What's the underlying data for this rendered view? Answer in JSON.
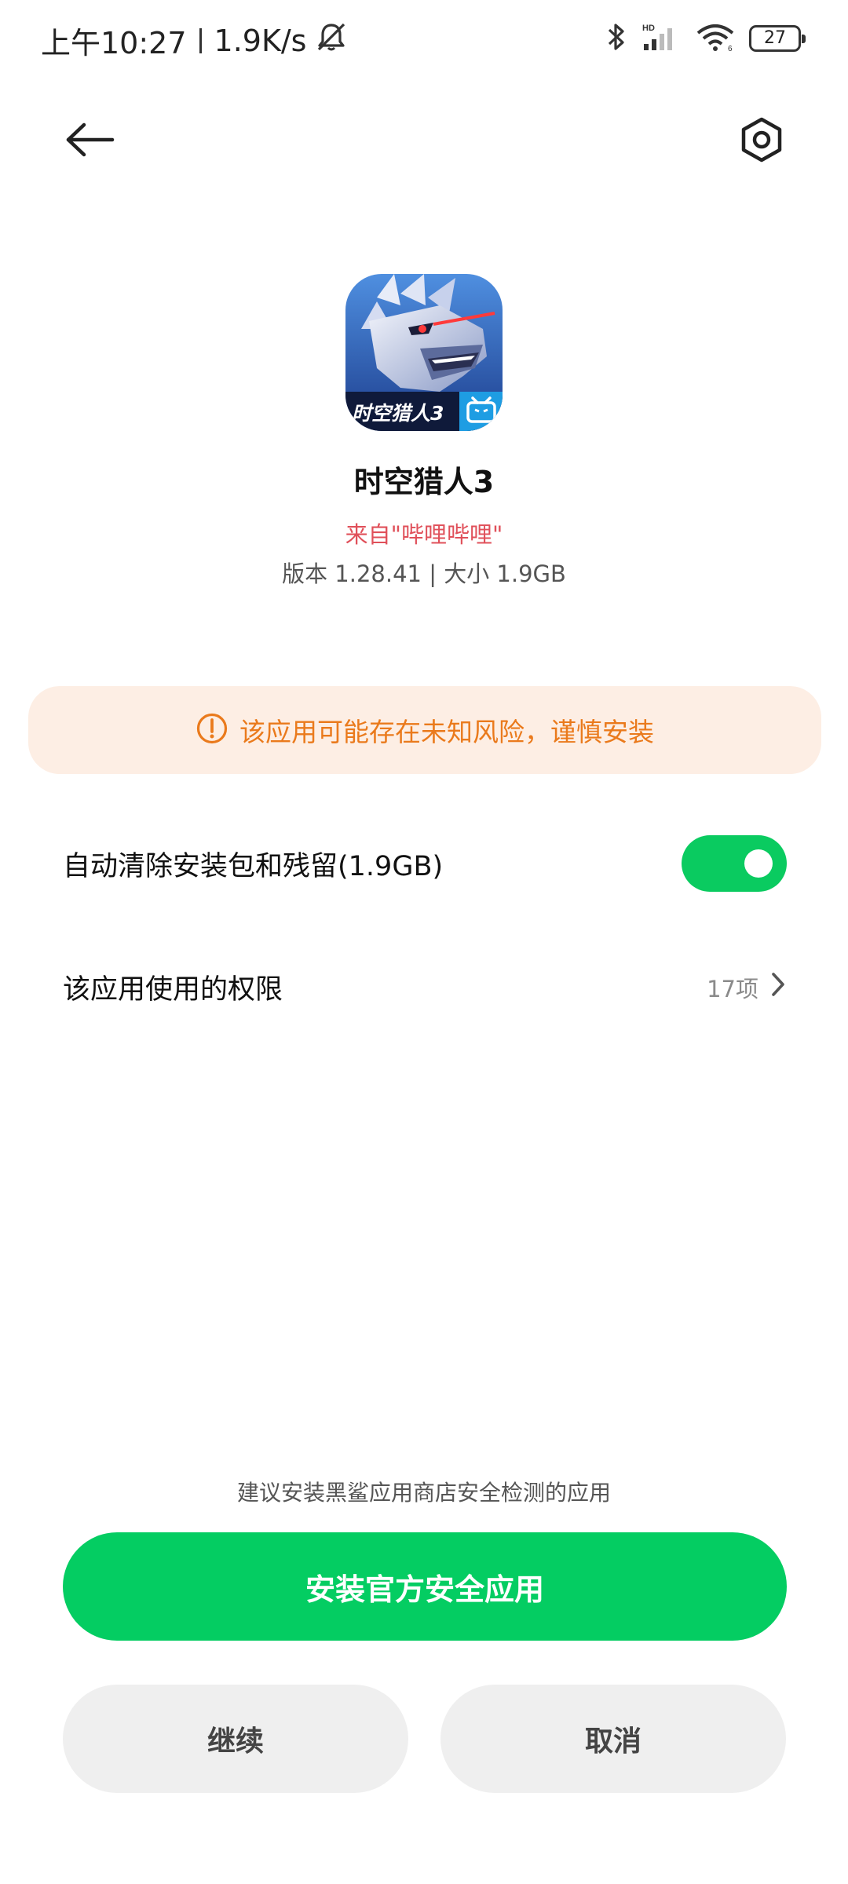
{
  "status_bar": {
    "time": "上午10:27",
    "network_speed": "1.9K/s",
    "battery_level": "27",
    "icons": [
      "mute-bell-icon",
      "bluetooth-icon",
      "hd-signal-icon",
      "wifi-icon",
      "battery-icon"
    ]
  },
  "toolbar": {
    "back_icon": "back-arrow-icon",
    "settings_icon": "settings-hexagon-icon"
  },
  "app": {
    "icon_text": "时空猎人3",
    "name": "时空猎人3",
    "source": "来自\"哔哩哔哩\"",
    "meta": "版本 1.28.41 | 大小 1.9GB"
  },
  "warning": {
    "icon": "alert-circle-icon",
    "text": "该应用可能存在未知风险，谨慎安装",
    "color": "#ea7a1c"
  },
  "settings": {
    "auto_clean_label": "自动清除安装包和残留(1.9GB)",
    "auto_clean_enabled": true,
    "permissions_label": "该应用使用的权限",
    "permissions_count": "17项"
  },
  "footer": {
    "hint": "建议安装黑鲨应用商店安全检测的应用",
    "install_official_label": "安装官方安全应用",
    "continue_label": "继续",
    "cancel_label": "取消",
    "accent_color": "#04cd62"
  }
}
